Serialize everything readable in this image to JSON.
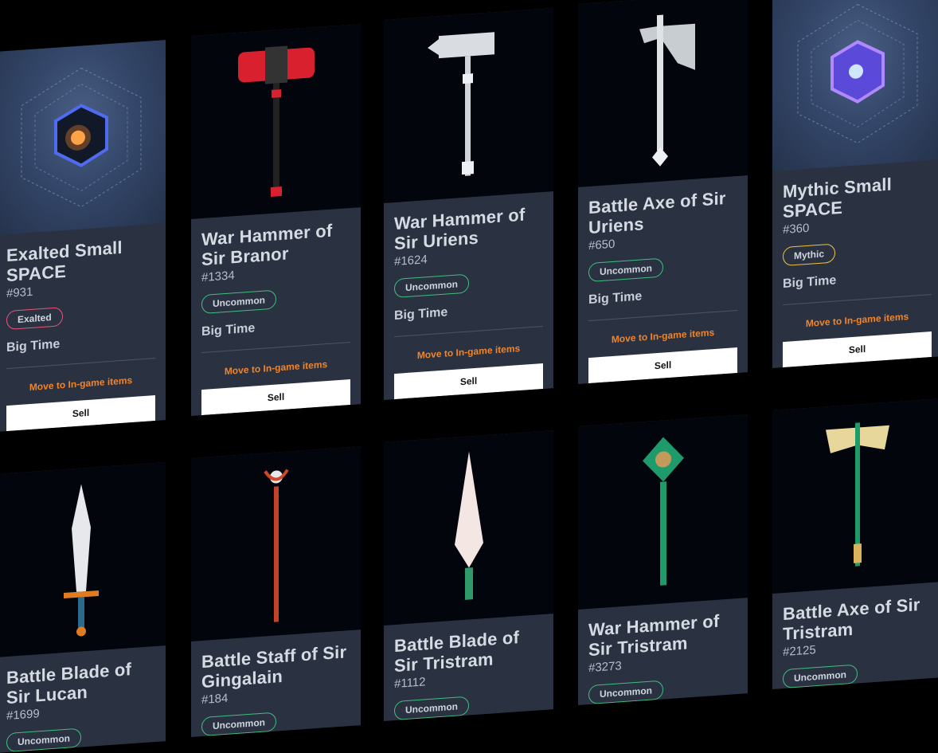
{
  "cards": [
    {
      "title": "Exalted Small SPACE",
      "number": "#931",
      "badge": "Exalted",
      "game": "Big Time",
      "move_label": "Move to In-game items",
      "sell_label": "Sell",
      "art": "space-cube-orange-icon"
    },
    {
      "title": "War Hammer of Sir Branor",
      "number": "#1334",
      "badge": "Uncommon",
      "game": "Big Time",
      "move_label": "Move to In-game items",
      "sell_label": "Sell",
      "art": "red-war-hammer-icon"
    },
    {
      "title": "War Hammer of Sir Uriens",
      "number": "#1624",
      "badge": "Uncommon",
      "game": "Big Time",
      "move_label": "Move to In-game items",
      "sell_label": "Sell",
      "art": "silver-war-hammer-icon"
    },
    {
      "title": "Battle Axe of Sir Uriens",
      "number": "#650",
      "badge": "Uncommon",
      "game": "Big Time",
      "move_label": "Move to In-game items",
      "sell_label": "Sell",
      "art": "silver-battle-axe-icon"
    },
    {
      "title": "Mythic Small SPACE",
      "number": "#360",
      "badge": "Mythic",
      "game": "Big Time",
      "move_label": "Move to In-game items",
      "sell_label": "Sell",
      "art": "space-cube-purple-icon"
    },
    {
      "title": "Battle Blade of Sir Lucan",
      "number": "#1699",
      "badge": "Uncommon",
      "art": "silver-sword-icon"
    },
    {
      "title": "Battle Staff of Sir Gingalain",
      "number": "#184",
      "badge": "Uncommon",
      "art": "red-staff-icon"
    },
    {
      "title": "Battle Blade of Sir Tristram",
      "number": "#1112",
      "badge": "Uncommon",
      "art": "white-blade-icon"
    },
    {
      "title": "War Hammer of Sir Tristram",
      "number": "#3273",
      "badge": "Uncommon",
      "art": "green-war-hammer-icon"
    },
    {
      "title": "Battle Axe of Sir Tristram",
      "number": "#2125",
      "badge": "Uncommon",
      "art": "gold-battle-axe-icon"
    }
  ],
  "colors": {
    "card_bg": "#2a3242",
    "uncommon": "#3fbf7f",
    "exalted": "#e8567a",
    "mythic": "#f0c43c",
    "move_link": "#f0842a"
  }
}
